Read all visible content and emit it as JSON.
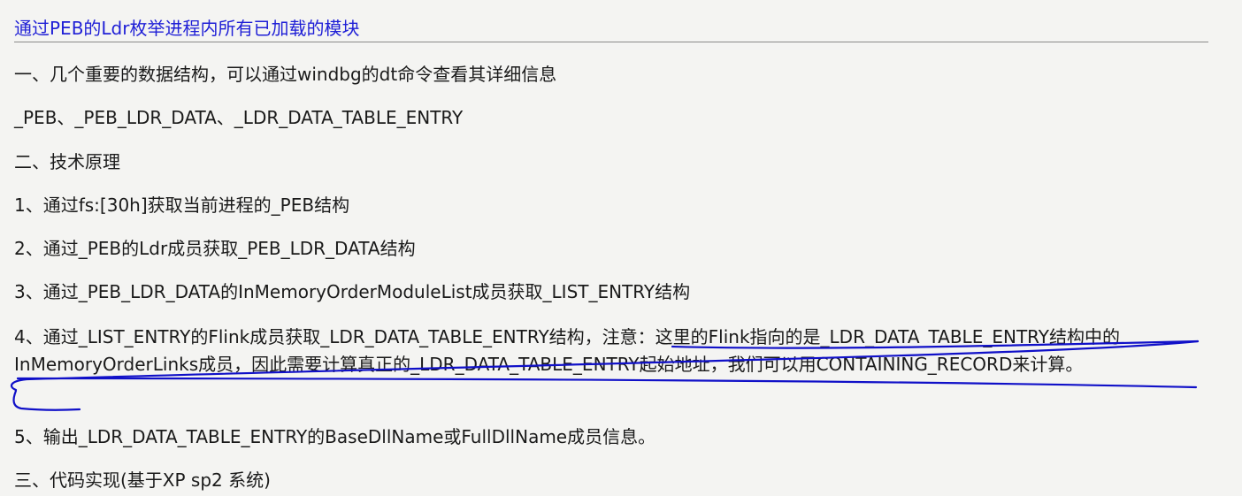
{
  "article": {
    "title": "通过PEB的Ldr枚举进程内所有已加载的模块",
    "paragraphs": [
      "一、几个重要的数据结构，可以通过windbg的dt命令查看其详细信息",
      "_PEB、_PEB_LDR_DATA、_LDR_DATA_TABLE_ENTRY",
      "二、技术原理",
      "1、通过fs:[30h]获取当前进程的_PEB结构",
      "2、通过_PEB的Ldr成员获取_PEB_LDR_DATA结构",
      "3、通过_PEB_LDR_DATA的InMemoryOrderModuleList成员获取_LIST_ENTRY结构",
      "4、通过_LIST_ENTRY的Flink成员获取_LDR_DATA_TABLE_ENTRY结构，注意：这里的Flink指向的是_LDR_DATA_TABLE_ENTRY结构中的InMemoryOrderLinks成员，因此需要计算真正的_LDR_DATA_TABLE_ENTRY起始地址，我们可以用CONTAINING_RECORD来计算。",
      "5、输出_LDR_DATA_TABLE_ENTRY的BaseDllName或FullDllName成员信息。",
      "三、代码实现(基于XP sp2 系统)"
    ]
  },
  "colors": {
    "title": "#1f1fd6",
    "annotation": "#1010c8",
    "text": "#1a1a1a",
    "background": "#f4f4f2"
  }
}
